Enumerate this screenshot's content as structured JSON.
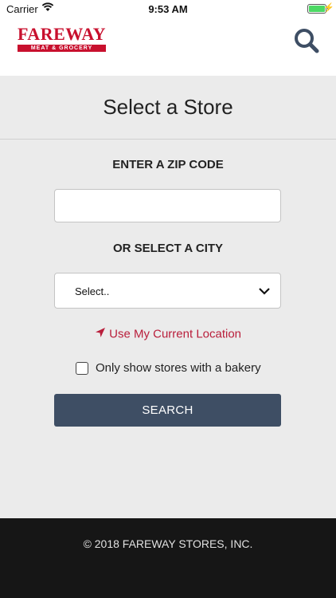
{
  "status_bar": {
    "carrier": "Carrier",
    "time": "9:53 AM"
  },
  "header": {
    "logo_main": "FAREWAY",
    "logo_sub": "MEAT & GROCERY",
    "logo_color": "#c8102e",
    "search_icon": "search-icon"
  },
  "page": {
    "title": "Select a Store"
  },
  "form": {
    "zip_label": "ENTER A ZIP CODE",
    "zip_value": "",
    "city_label": "OR SELECT A CITY",
    "city_selected": "Select..",
    "location_link": "Use My Current Location",
    "location_icon": "location-arrow-icon",
    "bakery_checkbox_label": "Only show stores with a bakery",
    "bakery_checked": false,
    "search_button": "SEARCH",
    "button_color": "#3e4e64",
    "link_color": "#b91e3b"
  },
  "footer": {
    "copyright": "© 2018 FAREWAY STORES, INC."
  }
}
